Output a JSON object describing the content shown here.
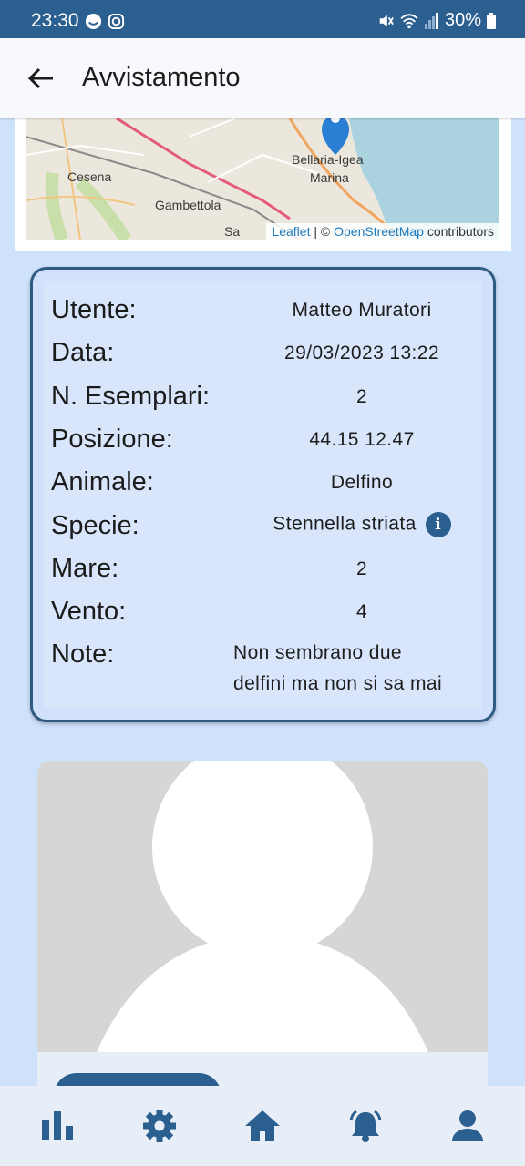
{
  "status_bar": {
    "time": "23:30",
    "battery": "30%"
  },
  "app_bar": {
    "title": "Avvistamento"
  },
  "map": {
    "labels": {
      "city1": "Cesena",
      "city2": "Gambettola",
      "city3": "Bellaria-Igea",
      "city3b": "Marina",
      "city4": "Sa"
    },
    "attribution": {
      "leaflet": "Leaflet",
      "sep": " | © ",
      "osm": "OpenStreetMap",
      "suffix": " contributors"
    }
  },
  "details": {
    "user": {
      "label": "Utente:",
      "value": "Matteo Muratori"
    },
    "date": {
      "label": "Data:",
      "value": "29/03/2023 13:22"
    },
    "count": {
      "label": "N. Esemplari:",
      "value": "2"
    },
    "position": {
      "label": "Posizione:",
      "value": "44.15 12.47"
    },
    "animal": {
      "label": "Animale:",
      "value": "Delfino"
    },
    "species": {
      "label": "Specie:",
      "value": "Stennella striata"
    },
    "sea": {
      "label": "Mare:",
      "value": "2"
    },
    "wind": {
      "label": "Vento:",
      "value": "4"
    },
    "notes": {
      "label": "Note:",
      "value_line1": "Non sembrano due",
      "value_line2": "delfini ma non si sa mai"
    }
  },
  "bottom_nav": [
    "chart-icon",
    "gear-icon",
    "home-icon",
    "bell-icon",
    "person-icon"
  ],
  "colors": {
    "primary": "#2b5f8f",
    "background": "#cfe2fb",
    "card": "#d8e5fb"
  }
}
